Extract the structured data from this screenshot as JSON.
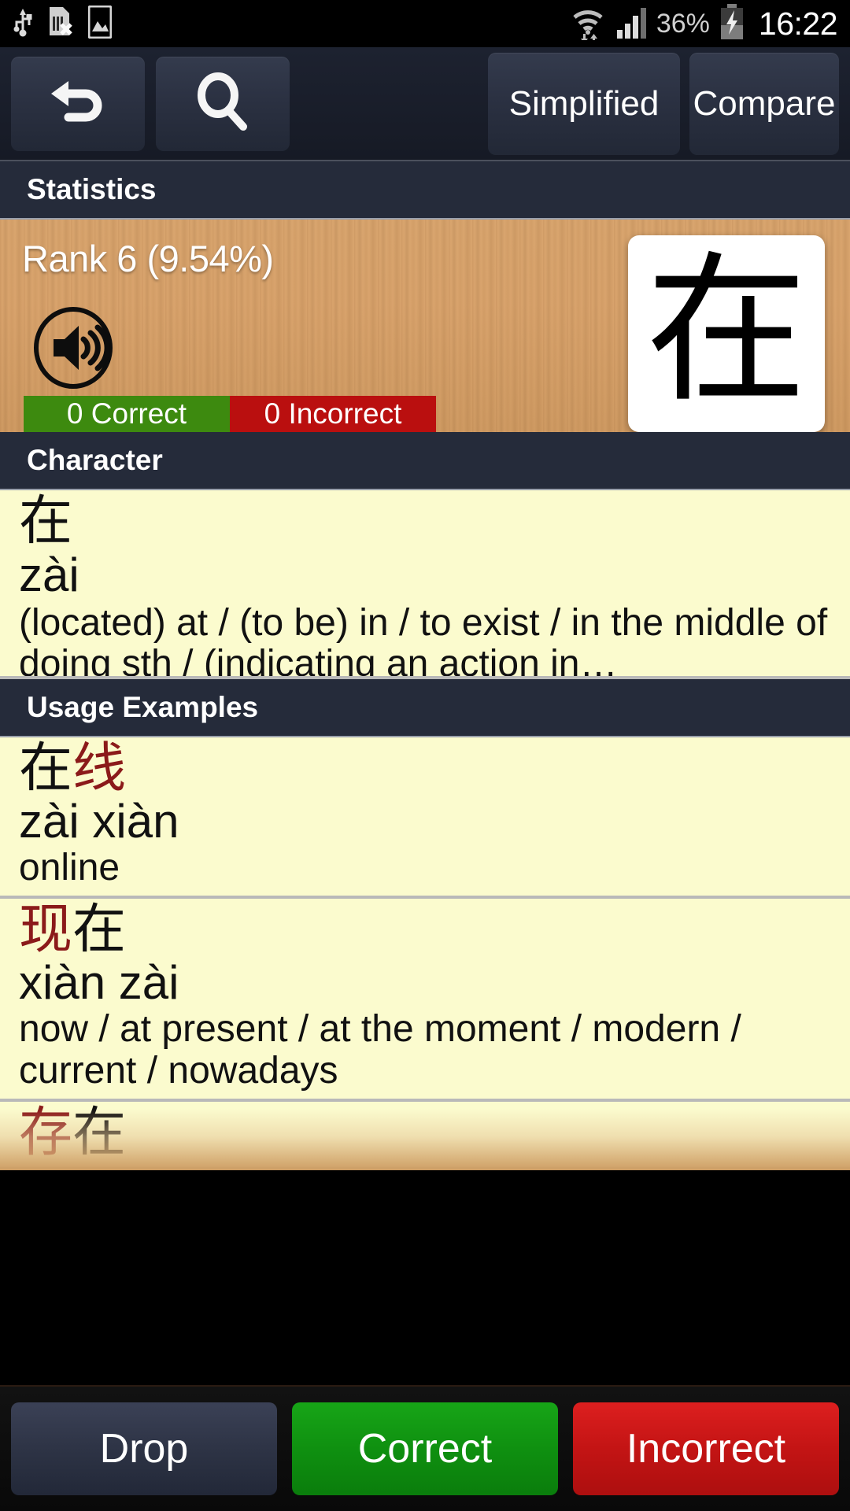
{
  "status_bar": {
    "time": "16:22",
    "battery_percent": "36%",
    "icons": [
      "usb-icon",
      "sim-card-error-icon",
      "image-icon",
      "wifi-icon",
      "signal-bars-icon",
      "battery-charging-icon"
    ]
  },
  "toolbar": {
    "back_icon": "back-arrow-icon",
    "search_icon": "search-icon",
    "simplified_label": "Simplified",
    "compare_label": "Compare"
  },
  "statistics": {
    "header": "Statistics",
    "rank_label": "Rank 6 (9.54%)",
    "audio_icon": "speaker-icon",
    "flashcard_character": "在",
    "correct_label": "0 Correct",
    "incorrect_label": "0 Incorrect",
    "correct_color": "#3d8a0f",
    "incorrect_color": "#ba0f0f"
  },
  "character": {
    "header": "Character",
    "hanzi": "在",
    "pinyin": "zài",
    "definition": "(located) at / (to be) in / to exist / in the middle of doing sth / (indicating an action in…"
  },
  "usage": {
    "header": "Usage Examples",
    "highlight_color": "#8b1a1a",
    "items": [
      {
        "hanzi_plain": "在",
        "hanzi_highlight": "线",
        "highlight_first": false,
        "pinyin": "zài xiàn",
        "definition": "online"
      },
      {
        "hanzi_plain": "在",
        "hanzi_highlight": "现",
        "highlight_first": true,
        "pinyin": "xiàn zài",
        "definition": "now / at present / at the moment / modern / current / nowadays"
      },
      {
        "hanzi_plain": "在",
        "hanzi_highlight": "存",
        "highlight_first": true,
        "pinyin": "",
        "definition": ""
      }
    ]
  },
  "actions": {
    "drop_label": "Drop",
    "correct_label": "Correct",
    "incorrect_label": "Incorrect"
  }
}
